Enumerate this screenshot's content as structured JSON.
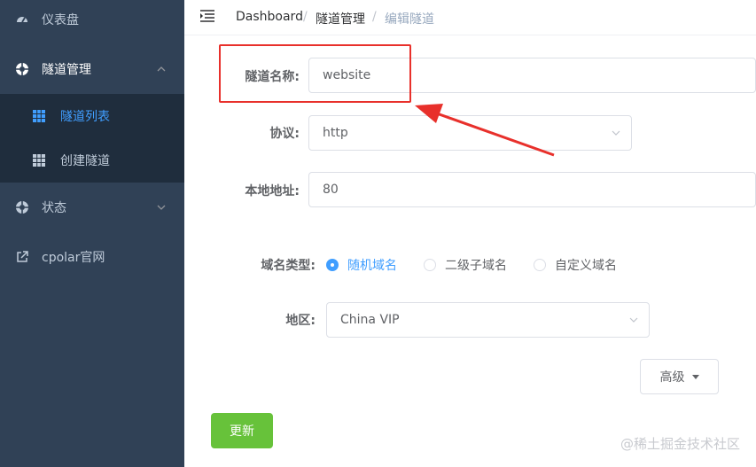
{
  "sidebar": {
    "items": [
      {
        "label": "仪表盘",
        "icon": "dashboard-icon"
      },
      {
        "label": "隧道管理",
        "icon": "lifebuoy-icon"
      },
      {
        "label": "状态",
        "icon": "lifebuoy-icon"
      },
      {
        "label": "cpolar官网",
        "icon": "external-link-icon"
      }
    ],
    "subitems": [
      {
        "label": "隧道列表",
        "active": true,
        "icon": "table-icon"
      },
      {
        "label": "创建隧道",
        "active": false,
        "icon": "table-icon"
      }
    ]
  },
  "breadcrumb": {
    "home": "Dashboard",
    "section": "隧道管理",
    "current": "编辑隧道",
    "separator": "/"
  },
  "form": {
    "name_label": "隧道名称:",
    "name_value": "website",
    "protocol_label": "协议:",
    "protocol_value": "http",
    "local_label": "本地地址:",
    "local_value": "80",
    "domain_type_label": "域名类型:",
    "domain_options": [
      "随机域名",
      "二级子域名",
      "自定义域名"
    ],
    "domain_selected": "随机域名",
    "region_label": "地区:",
    "region_value": "China VIP",
    "advanced_label": "高级",
    "update_label": "更新"
  },
  "watermark": "@稀土掘金技术社区",
  "colors": {
    "sidebar_bg": "#304156",
    "submenu_bg": "#1f2d3d",
    "accent": "#409eff",
    "success": "#67c23a",
    "annotation": "#e8302b"
  }
}
